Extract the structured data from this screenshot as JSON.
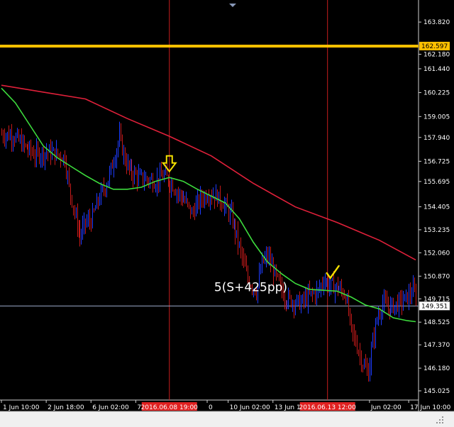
{
  "chart_data": {
    "type": "line",
    "colors": {
      "background": "#000000",
      "price_bar": "#1e3cff",
      "price_bar_down": "#c41a1a",
      "fast_ma": "#3ddc3d",
      "slow_ma": "#e0203a",
      "level_line": "#ffc000",
      "current_line": "#9aa8c8",
      "vertical_marker": "#c81e1e",
      "arrow": "#f4e000",
      "check": "#f4e000"
    },
    "ylim": [
      144.7,
      164.8
    ],
    "y_ticks": [
      "163.820",
      "162.180",
      "161.440",
      "160.225",
      "159.005",
      "157.940",
      "156.725",
      "155.695",
      "154.405",
      "153.235",
      "152.060",
      "150.870",
      "149.715",
      "148.525",
      "147.370",
      "146.180",
      "145.025"
    ],
    "y_tick_values": [
      163.82,
      162.18,
      161.44,
      160.225,
      159.005,
      157.94,
      156.725,
      155.695,
      154.405,
      153.235,
      152.06,
      150.87,
      149.715,
      148.525,
      147.37,
      146.18,
      145.025
    ],
    "x_ticks": [
      {
        "label": "1 Jun 10:00",
        "bar": 0
      },
      {
        "label": "2 Jun 18:00",
        "bar": 32
      },
      {
        "label": "6 Jun 02:00",
        "bar": 64
      },
      {
        "label": "7 Jun",
        "bar": 96
      },
      {
        "label": "0",
        "bar": 147
      },
      {
        "label": "10 Jun 02:00",
        "bar": 162
      },
      {
        "label": "13 Jun 10:00",
        "bar": 194
      },
      {
        "label": "Jun 02:00",
        "bar": 263
      },
      {
        "label": "17 Jun 10:00",
        "bar": 291
      }
    ],
    "highlighted_ticks": [
      {
        "label": "2016.06.08 19:00",
        "bar": 120
      },
      {
        "label": "2016.06.13 12:00",
        "bar": 233
      }
    ],
    "level_line": {
      "value": 162.597,
      "label": "162.597"
    },
    "current_price": {
      "value": 149.351,
      "label": "149.351"
    },
    "annotation": {
      "text": "5(S+425pp)",
      "bar": 152,
      "value": 150.1
    },
    "arrow_marker": {
      "bar": 120,
      "value": 156.35
    },
    "check_marker": {
      "bar": 236,
      "value": 151.1
    },
    "bars_count": 296,
    "price_path": [
      [
        0,
        158.1
      ],
      [
        8,
        158.05
      ],
      [
        16,
        157.5
      ],
      [
        24,
        157.05
      ],
      [
        32,
        157.2
      ],
      [
        40,
        157.1
      ],
      [
        45,
        156.9
      ],
      [
        48,
        155.4
      ],
      [
        52,
        154.1
      ],
      [
        56,
        152.9
      ],
      [
        60,
        153.6
      ],
      [
        64,
        153.7
      ],
      [
        70,
        154.9
      ],
      [
        75,
        155.6
      ],
      [
        80,
        156.8
      ],
      [
        84,
        157.95
      ],
      [
        88,
        156.8
      ],
      [
        92,
        156.2
      ],
      [
        98,
        155.9
      ],
      [
        104,
        155.8
      ],
      [
        110,
        155.7
      ],
      [
        116,
        156.0
      ],
      [
        120,
        155.7
      ],
      [
        126,
        155.1
      ],
      [
        132,
        154.6
      ],
      [
        136,
        154.05
      ],
      [
        142,
        154.8
      ],
      [
        148,
        155.1
      ],
      [
        154,
        154.9
      ],
      [
        158,
        154.6
      ],
      [
        164,
        153.95
      ],
      [
        168,
        152.9
      ],
      [
        172,
        151.8
      ],
      [
        176,
        150.7
      ],
      [
        182,
        150.1
      ],
      [
        186,
        151.5
      ],
      [
        190,
        151.9
      ],
      [
        196,
        150.8
      ],
      [
        202,
        149.8
      ],
      [
        208,
        149.6
      ],
      [
        214,
        149.5
      ],
      [
        220,
        149.9
      ],
      [
        226,
        150.1
      ],
      [
        230,
        150.7
      ],
      [
        234,
        150.4
      ],
      [
        240,
        150.3
      ],
      [
        246,
        149.9
      ],
      [
        250,
        148.1
      ],
      [
        254,
        147.3
      ],
      [
        258,
        146.4
      ],
      [
        262,
        145.9
      ],
      [
        264,
        147.1
      ],
      [
        268,
        148.7
      ],
      [
        272,
        149.5
      ],
      [
        276,
        149.25
      ],
      [
        280,
        149.35
      ],
      [
        286,
        149.6
      ],
      [
        290,
        149.8
      ],
      [
        294,
        150.1
      ],
      [
        296,
        149.9
      ]
    ],
    "fast_ma": [
      [
        0,
        160.45
      ],
      [
        10,
        159.7
      ],
      [
        20,
        158.6
      ],
      [
        30,
        157.5
      ],
      [
        40,
        156.9
      ],
      [
        50,
        156.45
      ],
      [
        60,
        156.0
      ],
      [
        70,
        155.6
      ],
      [
        80,
        155.3
      ],
      [
        90,
        155.3
      ],
      [
        100,
        155.4
      ],
      [
        110,
        155.7
      ],
      [
        120,
        155.9
      ],
      [
        130,
        155.7
      ],
      [
        140,
        155.3
      ],
      [
        150,
        154.95
      ],
      [
        160,
        154.6
      ],
      [
        170,
        153.8
      ],
      [
        180,
        152.6
      ],
      [
        190,
        151.6
      ],
      [
        200,
        151.0
      ],
      [
        210,
        150.5
      ],
      [
        220,
        150.2
      ],
      [
        230,
        150.15
      ],
      [
        240,
        150.1
      ],
      [
        250,
        149.8
      ],
      [
        260,
        149.4
      ],
      [
        270,
        149.2
      ],
      [
        280,
        148.75
      ],
      [
        290,
        148.6
      ],
      [
        296,
        148.55
      ]
    ],
    "slow_ma": [
      [
        0,
        160.6
      ],
      [
        30,
        160.25
      ],
      [
        60,
        159.9
      ],
      [
        90,
        158.9
      ],
      [
        120,
        158.0
      ],
      [
        150,
        157.0
      ],
      [
        180,
        155.6
      ],
      [
        210,
        154.4
      ],
      [
        240,
        153.6
      ],
      [
        270,
        152.7
      ],
      [
        296,
        151.7
      ]
    ]
  }
}
